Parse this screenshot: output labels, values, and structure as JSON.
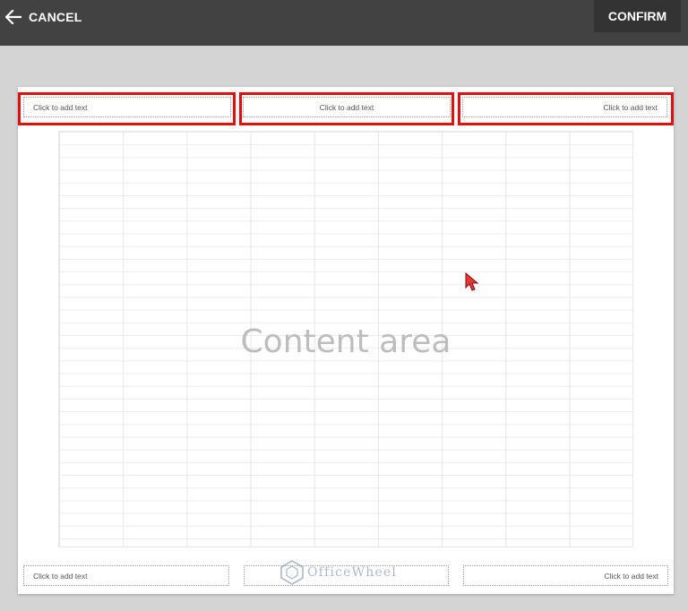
{
  "toolbar": {
    "cancel_label": "CANCEL",
    "confirm_label": "CONFIRM"
  },
  "header": {
    "left_placeholder": "Click to add text",
    "center_placeholder": "Click to add text",
    "right_placeholder": "Click to add text"
  },
  "content": {
    "label": "Content area"
  },
  "footer": {
    "left_placeholder": "Click to add text",
    "center_placeholder": "",
    "right_placeholder": "Click to add text"
  },
  "watermark": {
    "text": "OfficeWheel"
  },
  "colors": {
    "topbar": "#424242",
    "confirm_bg": "#333333",
    "highlight": "#e01010",
    "canvas_bg": "#d4d4d4",
    "cursor": "#e53935"
  }
}
